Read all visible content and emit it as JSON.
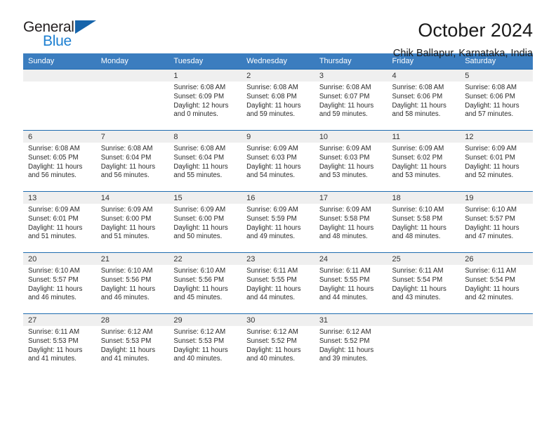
{
  "brand": {
    "name_part1": "General",
    "name_part2": "Blue"
  },
  "header": {
    "title": "October 2024",
    "subtitle": "Chik Ballapur, Karnataka, India"
  },
  "colors": {
    "header_blue": "#3b7dbf",
    "row_rule_blue": "#1f6cb0",
    "daynum_band": "#efefef",
    "brand_blue": "#1c7fd1",
    "brand_triangle": "#1664ab"
  },
  "weekday_headers": [
    "Sunday",
    "Monday",
    "Tuesday",
    "Wednesday",
    "Thursday",
    "Friday",
    "Saturday"
  ],
  "weeks": [
    [
      {
        "day": "",
        "sunrise": "",
        "sunset": "",
        "daylight_line1": "",
        "daylight_line2": ""
      },
      {
        "day": "",
        "sunrise": "",
        "sunset": "",
        "daylight_line1": "",
        "daylight_line2": ""
      },
      {
        "day": "1",
        "sunrise": "Sunrise: 6:08 AM",
        "sunset": "Sunset: 6:09 PM",
        "daylight_line1": "Daylight: 12 hours",
        "daylight_line2": "and 0 minutes."
      },
      {
        "day": "2",
        "sunrise": "Sunrise: 6:08 AM",
        "sunset": "Sunset: 6:08 PM",
        "daylight_line1": "Daylight: 11 hours",
        "daylight_line2": "and 59 minutes."
      },
      {
        "day": "3",
        "sunrise": "Sunrise: 6:08 AM",
        "sunset": "Sunset: 6:07 PM",
        "daylight_line1": "Daylight: 11 hours",
        "daylight_line2": "and 59 minutes."
      },
      {
        "day": "4",
        "sunrise": "Sunrise: 6:08 AM",
        "sunset": "Sunset: 6:06 PM",
        "daylight_line1": "Daylight: 11 hours",
        "daylight_line2": "and 58 minutes."
      },
      {
        "day": "5",
        "sunrise": "Sunrise: 6:08 AM",
        "sunset": "Sunset: 6:06 PM",
        "daylight_line1": "Daylight: 11 hours",
        "daylight_line2": "and 57 minutes."
      }
    ],
    [
      {
        "day": "6",
        "sunrise": "Sunrise: 6:08 AM",
        "sunset": "Sunset: 6:05 PM",
        "daylight_line1": "Daylight: 11 hours",
        "daylight_line2": "and 56 minutes."
      },
      {
        "day": "7",
        "sunrise": "Sunrise: 6:08 AM",
        "sunset": "Sunset: 6:04 PM",
        "daylight_line1": "Daylight: 11 hours",
        "daylight_line2": "and 56 minutes."
      },
      {
        "day": "8",
        "sunrise": "Sunrise: 6:08 AM",
        "sunset": "Sunset: 6:04 PM",
        "daylight_line1": "Daylight: 11 hours",
        "daylight_line2": "and 55 minutes."
      },
      {
        "day": "9",
        "sunrise": "Sunrise: 6:09 AM",
        "sunset": "Sunset: 6:03 PM",
        "daylight_line1": "Daylight: 11 hours",
        "daylight_line2": "and 54 minutes."
      },
      {
        "day": "10",
        "sunrise": "Sunrise: 6:09 AM",
        "sunset": "Sunset: 6:03 PM",
        "daylight_line1": "Daylight: 11 hours",
        "daylight_line2": "and 53 minutes."
      },
      {
        "day": "11",
        "sunrise": "Sunrise: 6:09 AM",
        "sunset": "Sunset: 6:02 PM",
        "daylight_line1": "Daylight: 11 hours",
        "daylight_line2": "and 53 minutes."
      },
      {
        "day": "12",
        "sunrise": "Sunrise: 6:09 AM",
        "sunset": "Sunset: 6:01 PM",
        "daylight_line1": "Daylight: 11 hours",
        "daylight_line2": "and 52 minutes."
      }
    ],
    [
      {
        "day": "13",
        "sunrise": "Sunrise: 6:09 AM",
        "sunset": "Sunset: 6:01 PM",
        "daylight_line1": "Daylight: 11 hours",
        "daylight_line2": "and 51 minutes."
      },
      {
        "day": "14",
        "sunrise": "Sunrise: 6:09 AM",
        "sunset": "Sunset: 6:00 PM",
        "daylight_line1": "Daylight: 11 hours",
        "daylight_line2": "and 51 minutes."
      },
      {
        "day": "15",
        "sunrise": "Sunrise: 6:09 AM",
        "sunset": "Sunset: 6:00 PM",
        "daylight_line1": "Daylight: 11 hours",
        "daylight_line2": "and 50 minutes."
      },
      {
        "day": "16",
        "sunrise": "Sunrise: 6:09 AM",
        "sunset": "Sunset: 5:59 PM",
        "daylight_line1": "Daylight: 11 hours",
        "daylight_line2": "and 49 minutes."
      },
      {
        "day": "17",
        "sunrise": "Sunrise: 6:09 AM",
        "sunset": "Sunset: 5:58 PM",
        "daylight_line1": "Daylight: 11 hours",
        "daylight_line2": "and 48 minutes."
      },
      {
        "day": "18",
        "sunrise": "Sunrise: 6:10 AM",
        "sunset": "Sunset: 5:58 PM",
        "daylight_line1": "Daylight: 11 hours",
        "daylight_line2": "and 48 minutes."
      },
      {
        "day": "19",
        "sunrise": "Sunrise: 6:10 AM",
        "sunset": "Sunset: 5:57 PM",
        "daylight_line1": "Daylight: 11 hours",
        "daylight_line2": "and 47 minutes."
      }
    ],
    [
      {
        "day": "20",
        "sunrise": "Sunrise: 6:10 AM",
        "sunset": "Sunset: 5:57 PM",
        "daylight_line1": "Daylight: 11 hours",
        "daylight_line2": "and 46 minutes."
      },
      {
        "day": "21",
        "sunrise": "Sunrise: 6:10 AM",
        "sunset": "Sunset: 5:56 PM",
        "daylight_line1": "Daylight: 11 hours",
        "daylight_line2": "and 46 minutes."
      },
      {
        "day": "22",
        "sunrise": "Sunrise: 6:10 AM",
        "sunset": "Sunset: 5:56 PM",
        "daylight_line1": "Daylight: 11 hours",
        "daylight_line2": "and 45 minutes."
      },
      {
        "day": "23",
        "sunrise": "Sunrise: 6:11 AM",
        "sunset": "Sunset: 5:55 PM",
        "daylight_line1": "Daylight: 11 hours",
        "daylight_line2": "and 44 minutes."
      },
      {
        "day": "24",
        "sunrise": "Sunrise: 6:11 AM",
        "sunset": "Sunset: 5:55 PM",
        "daylight_line1": "Daylight: 11 hours",
        "daylight_line2": "and 44 minutes."
      },
      {
        "day": "25",
        "sunrise": "Sunrise: 6:11 AM",
        "sunset": "Sunset: 5:54 PM",
        "daylight_line1": "Daylight: 11 hours",
        "daylight_line2": "and 43 minutes."
      },
      {
        "day": "26",
        "sunrise": "Sunrise: 6:11 AM",
        "sunset": "Sunset: 5:54 PM",
        "daylight_line1": "Daylight: 11 hours",
        "daylight_line2": "and 42 minutes."
      }
    ],
    [
      {
        "day": "27",
        "sunrise": "Sunrise: 6:11 AM",
        "sunset": "Sunset: 5:53 PM",
        "daylight_line1": "Daylight: 11 hours",
        "daylight_line2": "and 41 minutes."
      },
      {
        "day": "28",
        "sunrise": "Sunrise: 6:12 AM",
        "sunset": "Sunset: 5:53 PM",
        "daylight_line1": "Daylight: 11 hours",
        "daylight_line2": "and 41 minutes."
      },
      {
        "day": "29",
        "sunrise": "Sunrise: 6:12 AM",
        "sunset": "Sunset: 5:53 PM",
        "daylight_line1": "Daylight: 11 hours",
        "daylight_line2": "and 40 minutes."
      },
      {
        "day": "30",
        "sunrise": "Sunrise: 6:12 AM",
        "sunset": "Sunset: 5:52 PM",
        "daylight_line1": "Daylight: 11 hours",
        "daylight_line2": "and 40 minutes."
      },
      {
        "day": "31",
        "sunrise": "Sunrise: 6:12 AM",
        "sunset": "Sunset: 5:52 PM",
        "daylight_line1": "Daylight: 11 hours",
        "daylight_line2": "and 39 minutes."
      },
      {
        "day": "",
        "sunrise": "",
        "sunset": "",
        "daylight_line1": "",
        "daylight_line2": ""
      },
      {
        "day": "",
        "sunrise": "",
        "sunset": "",
        "daylight_line1": "",
        "daylight_line2": ""
      }
    ]
  ]
}
